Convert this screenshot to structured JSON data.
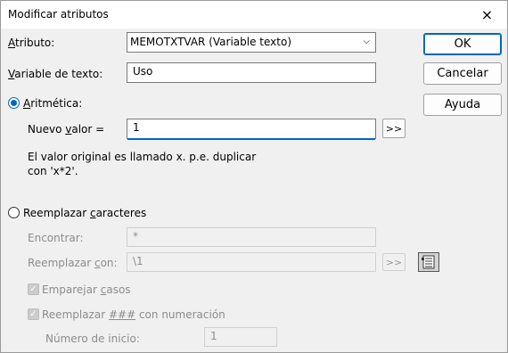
{
  "window": {
    "title": "Modificar atributos"
  },
  "atributo": {
    "label": "Atributo:",
    "value": "MEMOTXTVAR (Variable texto)"
  },
  "variable": {
    "label": "Variable de texto:",
    "value": "Uso"
  },
  "aritmetica": {
    "label": "Aritmética:",
    "nuevo_valor_label": "Nuevo valor =",
    "nuevo_valor_value": "1",
    "expand": ">>",
    "help_line1": "El valor original es llamado x. p.e. duplicar",
    "help_line2": "con 'x*2'."
  },
  "reemplazar": {
    "label": "Reemplazar caracteres",
    "encontrar_label": "Encontrar:",
    "encontrar_value": "*",
    "reemplazar_con_label": "Reemplazar con:",
    "reemplazar_con_value": "\\1",
    "expand": ">>",
    "emparejar_label": "Emparejar casos",
    "numeracion_label": "Reemplazar ### con numeración",
    "numero_inicio_label": "Número de inicio:",
    "numero_inicio_value": "1"
  },
  "buttons": {
    "ok": "OK",
    "cancel": "Cancelar",
    "help": "Ayuda"
  },
  "icons": {
    "close": "×",
    "dropdown": "⌵",
    "check": "✓"
  },
  "colors": {
    "accent": "#0067c0",
    "disabled_text": "#8c8c8c"
  }
}
